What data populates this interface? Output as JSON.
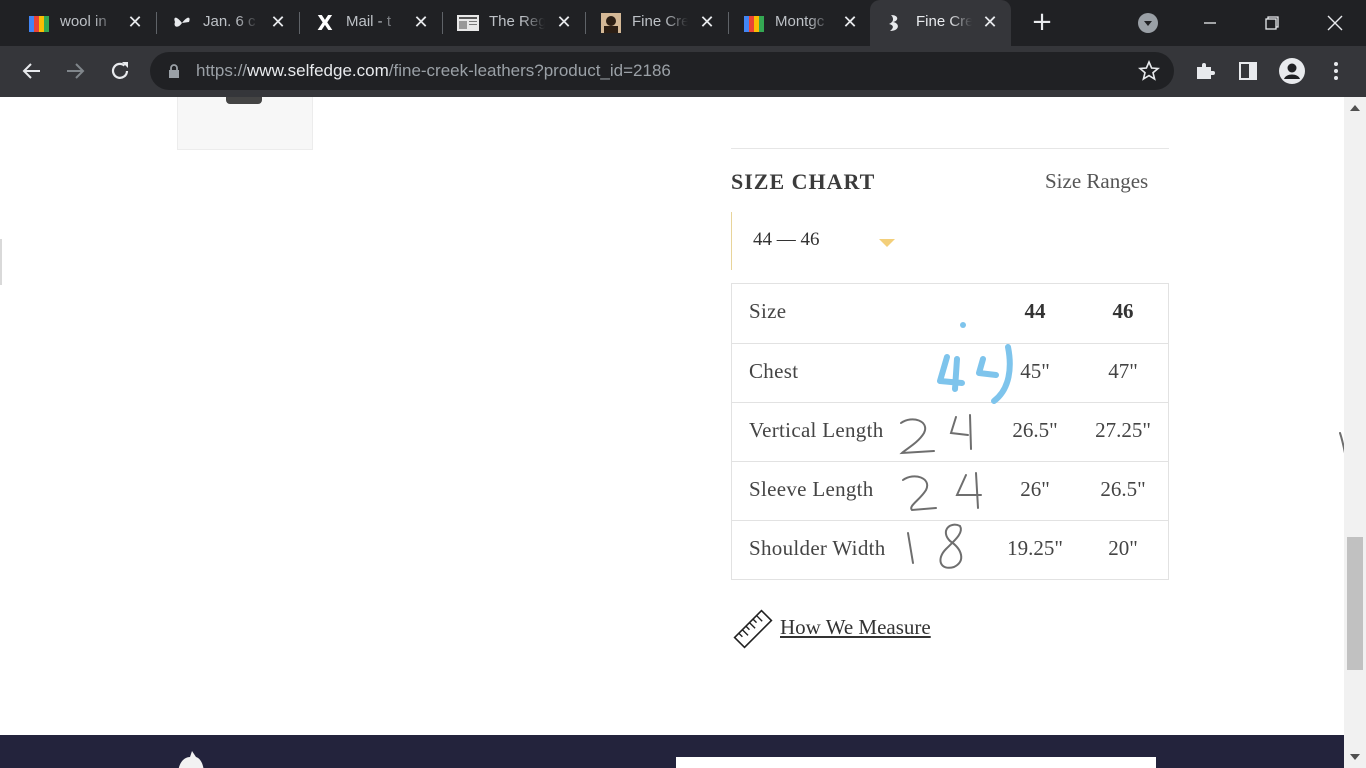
{
  "browser": {
    "tabs": [
      {
        "title": "wool in",
        "icon": "gmail-icon"
      },
      {
        "title": "Jan. 6 c",
        "icon": "butterfly-icon"
      },
      {
        "title": "Mail - t",
        "icon": "x-icon"
      },
      {
        "title": "The Reg",
        "icon": "newspaper-icon"
      },
      {
        "title": "Fine Cre",
        "icon": "portrait-icon"
      },
      {
        "title": "Montgc",
        "icon": "gmail-icon"
      },
      {
        "title": "Fine Cre",
        "icon": "fine-creek-logo-icon",
        "active": true
      }
    ],
    "url_prefix": "https://",
    "url_host": "www.selfedge.com",
    "url_path": "/fine-creek-leathers?product_id=2186"
  },
  "size_chart": {
    "title": "SIZE CHART",
    "ranges_label": "Size Ranges",
    "selected_range": "44 — 46",
    "rows": [
      {
        "label": "Size",
        "v1": "44",
        "v2": "46"
      },
      {
        "label": "Chest",
        "v1": "45\"",
        "v2": "47\""
      },
      {
        "label": "Vertical Length",
        "v1": "26.5\"",
        "v2": "27.25\""
      },
      {
        "label": "Sleeve Length",
        "v1": "26\"",
        "v2": "26.5\""
      },
      {
        "label": "Shoulder Width",
        "v1": "19.25\"",
        "v2": "20\""
      }
    ],
    "how_we_measure": "How We Measure"
  },
  "colors": {
    "chrome_dark": "#202124",
    "chrome_toolbar": "#35363a",
    "caret_gold": "#f3cf7a",
    "footer_navy": "#23233c",
    "ink_blue": "#7ec4ec",
    "ink_gray": "#6e6e6e"
  }
}
